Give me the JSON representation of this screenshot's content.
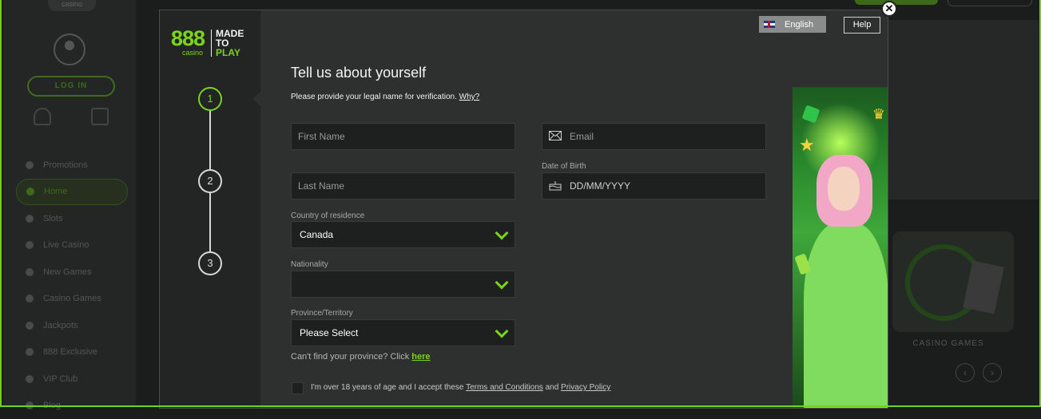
{
  "background": {
    "logo_tab": "casino",
    "login_label": "LOG IN",
    "nav_items": [
      {
        "label": "Promotions",
        "active": false
      },
      {
        "label": "Home",
        "active": true
      },
      {
        "label": "Slots",
        "active": false
      },
      {
        "label": "Live Casino",
        "active": false
      },
      {
        "label": "New Games",
        "active": false
      },
      {
        "label": "Casino Games",
        "active": false
      },
      {
        "label": "Jackpots",
        "active": false
      },
      {
        "label": "888 Exclusive",
        "active": false
      },
      {
        "label": "VIP Club",
        "active": false
      },
      {
        "label": "Blog",
        "active": false
      }
    ],
    "game_section_label": "CASINO GAMES",
    "prev_arrow": "‹",
    "next_arrow": "›"
  },
  "modal": {
    "logo": {
      "brand": "888",
      "sub": "casino",
      "tagline_1": "MADE",
      "tagline_2": "TO",
      "tagline_3": "PLAY"
    },
    "language_label": "English",
    "help_label": "Help",
    "close_glyph": "✕",
    "steps": [
      "1",
      "2",
      "3"
    ],
    "active_step": "1",
    "title": "Tell us about yourself",
    "subtitle": "Please provide your legal name for verification.",
    "why_link": "Why?",
    "first_name_placeholder": "First Name",
    "email_placeholder": "Email",
    "last_name_placeholder": "Last Name",
    "dob_label": "Date of Birth",
    "dob_placeholder": "DD/MM/YYYY",
    "country_label": "Country of residence",
    "country_value": "Canada",
    "nationality_label": "Nationality",
    "nationality_value": "",
    "province_label": "Province/Territory",
    "province_value": "Please Select",
    "province_hint": "Can't find your province? Click",
    "province_hint_link": "here",
    "terms_prefix": "I'm over 18 years of age and I accept these",
    "terms_link": "Terms and Conditions",
    "terms_and": "and",
    "privacy_link": "Privacy Policy"
  },
  "colors": {
    "accent": "#7ad41b",
    "modal_bg": "#2e2f2f",
    "field_bg": "#1e1f1f"
  }
}
